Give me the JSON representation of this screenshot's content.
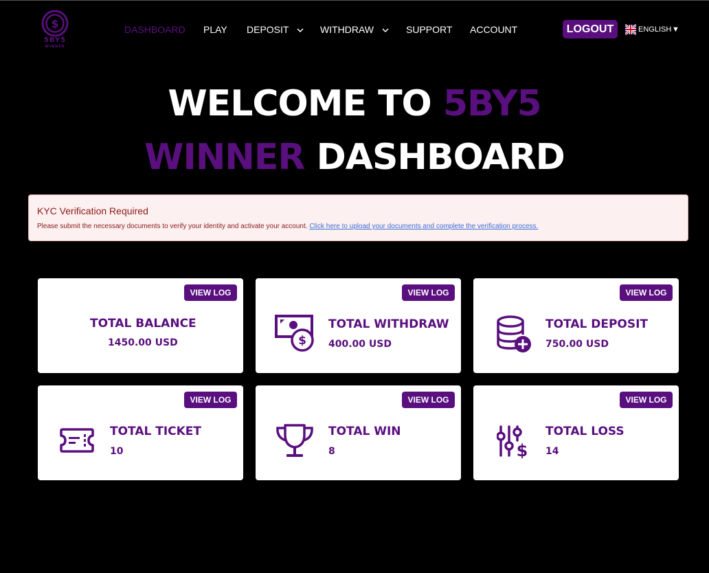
{
  "brand": {
    "logo_text": "5BY5",
    "logo_sub": "WINNER",
    "accent_color": "#5a0f7e"
  },
  "nav": {
    "items": [
      {
        "label": "DASHBOARD",
        "active": true
      },
      {
        "label": "PLAY",
        "active": false
      },
      {
        "label": "DEPOSIT",
        "active": false,
        "dropdown": true
      },
      {
        "label": "WITHDRAW",
        "active": false,
        "dropdown": true
      },
      {
        "label": "SUPPORT",
        "active": false
      },
      {
        "label": "ACCOUNT",
        "active": false
      }
    ],
    "logout_label": "LOGOUT",
    "language": {
      "label": "ENGLISH",
      "caret": "▼",
      "flag_icon": "uk-flag-icon"
    }
  },
  "hero": {
    "line1_white": "WELCOME TO",
    "line1_purple": "5BY5",
    "line2_purple": "WINNER",
    "line2_white": "DASHBOARD"
  },
  "alert": {
    "title": "KYC Verification Required",
    "message": "Please submit the necessary documents to verify your identity and activate your account.",
    "link": "Click here to upload your documents and complete the verification process."
  },
  "cards": [
    {
      "title": "TOTAL BALANCE",
      "value": "1450.00 USD",
      "button": "VIEW LOG",
      "icon": "none"
    },
    {
      "title": "TOTAL WITHDRAW",
      "value": "400.00 USD",
      "button": "VIEW LOG",
      "icon": "money-bill-icon"
    },
    {
      "title": "TOTAL DEPOSIT",
      "value": "750.00 USD",
      "button": "VIEW LOG",
      "icon": "database-plus-icon"
    },
    {
      "title": "TOTAL TICKET",
      "value": "10",
      "button": "VIEW LOG",
      "icon": "ticket-icon"
    },
    {
      "title": "TOTAL WIN",
      "value": "8",
      "button": "VIEW LOG",
      "icon": "trophy-icon"
    },
    {
      "title": "TOTAL LOSS",
      "value": "14",
      "button": "VIEW LOG",
      "icon": "sliders-dollar-icon"
    }
  ]
}
